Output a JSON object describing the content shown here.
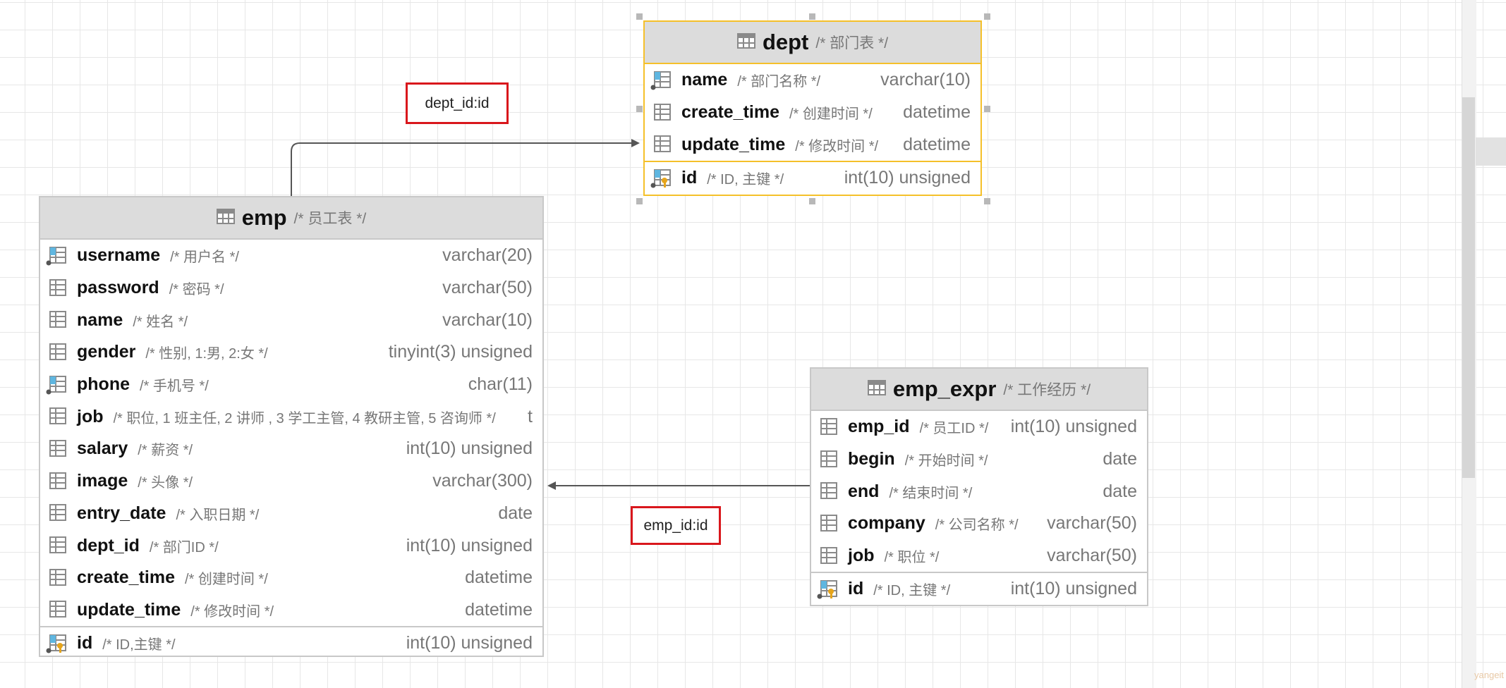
{
  "tables": {
    "dept": {
      "name": "dept",
      "comment": "/* 部门表 */",
      "columns": [
        {
          "name": "name",
          "comment": "/* 部门名称 */",
          "type": "varchar(10)",
          "icon": "column-indexed-icon"
        },
        {
          "name": "create_time",
          "comment": "/* 创建时间 */",
          "type": "datetime",
          "icon": "column-icon"
        },
        {
          "name": "update_time",
          "comment": "/* 修改时间 */",
          "type": "datetime",
          "icon": "column-icon"
        }
      ],
      "pk": {
        "name": "id",
        "comment": "/* ID, 主键 */",
        "type": "int(10) unsigned",
        "icon": "primary-key-icon"
      }
    },
    "emp": {
      "name": "emp",
      "comment": "/* 员工表 */",
      "columns": [
        {
          "name": "username",
          "comment": "/* 用户名 */",
          "type": "varchar(20)",
          "icon": "column-indexed-icon"
        },
        {
          "name": "password",
          "comment": "/* 密码 */",
          "type": "varchar(50)",
          "icon": "column-icon"
        },
        {
          "name": "name",
          "comment": "/* 姓名 */",
          "type": "varchar(10)",
          "icon": "column-icon"
        },
        {
          "name": "gender",
          "comment": "/* 性别, 1:男, 2:女 */",
          "type": "tinyint(3) unsigned",
          "icon": "column-icon"
        },
        {
          "name": "phone",
          "comment": "/* 手机号 */",
          "type": "char(11)",
          "icon": "column-indexed-icon"
        },
        {
          "name": "job",
          "comment": "/* 职位, 1 班主任, 2 讲师 , 3 学工主管, 4 教研主管, 5 咨询师 */",
          "type": "t",
          "icon": "column-icon"
        },
        {
          "name": "salary",
          "comment": "/* 薪资 */",
          "type": "int(10) unsigned",
          "icon": "column-icon"
        },
        {
          "name": "image",
          "comment": "/* 头像 */",
          "type": "varchar(300)",
          "icon": "column-icon"
        },
        {
          "name": "entry_date",
          "comment": "/* 入职日期 */",
          "type": "date",
          "icon": "column-icon"
        },
        {
          "name": "dept_id",
          "comment": "/* 部门ID */",
          "type": "int(10) unsigned",
          "icon": "column-icon"
        },
        {
          "name": "create_time",
          "comment": "/* 创建时间 */",
          "type": "datetime",
          "icon": "column-icon"
        },
        {
          "name": "update_time",
          "comment": "/* 修改时间 */",
          "type": "datetime",
          "icon": "column-icon"
        }
      ],
      "pk": {
        "name": "id",
        "comment": "/* ID,主键 */",
        "type": "int(10) unsigned",
        "icon": "primary-key-icon"
      }
    },
    "emp_expr": {
      "name": "emp_expr",
      "comment": "/* 工作经历 */",
      "columns": [
        {
          "name": "emp_id",
          "comment": "/* 员工ID */",
          "type": "int(10) unsigned",
          "icon": "column-icon"
        },
        {
          "name": "begin",
          "comment": "/* 开始时间 */",
          "type": "date",
          "icon": "column-icon"
        },
        {
          "name": "end",
          "comment": "/* 结束时间 */",
          "type": "date",
          "icon": "column-icon"
        },
        {
          "name": "company",
          "comment": "/* 公司名称 */",
          "type": "varchar(50)",
          "icon": "column-icon"
        },
        {
          "name": "job",
          "comment": "/* 职位 */",
          "type": "varchar(50)",
          "icon": "column-icon"
        }
      ],
      "pk": {
        "name": "id",
        "comment": "/* ID, 主键 */",
        "type": "int(10) unsigned",
        "icon": "primary-key-icon"
      }
    }
  },
  "relations": {
    "emp_to_dept": {
      "label": "dept_id:id"
    },
    "expr_to_emp": {
      "label": "emp_id:id"
    }
  },
  "colors": {
    "selected_border": "#f5c02a",
    "label_border": "#d9171c",
    "connector": "#555555"
  },
  "watermark": "yangeit"
}
